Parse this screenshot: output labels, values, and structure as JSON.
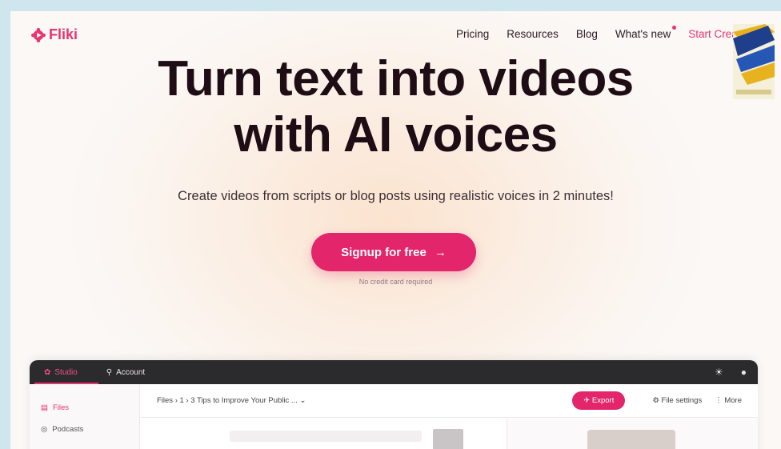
{
  "header": {
    "logo_text": "Fliki",
    "nav": [
      {
        "label": "Pricing"
      },
      {
        "label": "Resources"
      },
      {
        "label": "Blog"
      },
      {
        "label": "What's new"
      }
    ],
    "start_label": "Start Creatin"
  },
  "hero": {
    "title_line1": "Turn text into videos",
    "title_line2": "with AI voices",
    "subtitle": "Create videos from scripts or blog posts using realistic voices in 2 minutes!",
    "cta_label": "Signup for free",
    "cta_arrow": "→",
    "note": "No credit card required"
  },
  "app": {
    "tabs": [
      {
        "label": "Studio",
        "icon": "studio-icon"
      },
      {
        "label": "Account",
        "icon": "account-icon"
      }
    ],
    "sidebar": [
      {
        "label": "Files",
        "icon": "files-icon"
      },
      {
        "label": "Podcasts",
        "icon": "podcasts-icon"
      }
    ],
    "breadcrumb": "Files  ›  1  ›  3 Tips to Improve Your Public ...  ⌄",
    "export_label": "Export",
    "file_settings_label": "File settings",
    "more_label": "More"
  },
  "colors": {
    "brand": "#e8336f",
    "cta": "#e3256b",
    "title": "#1e0d15"
  }
}
